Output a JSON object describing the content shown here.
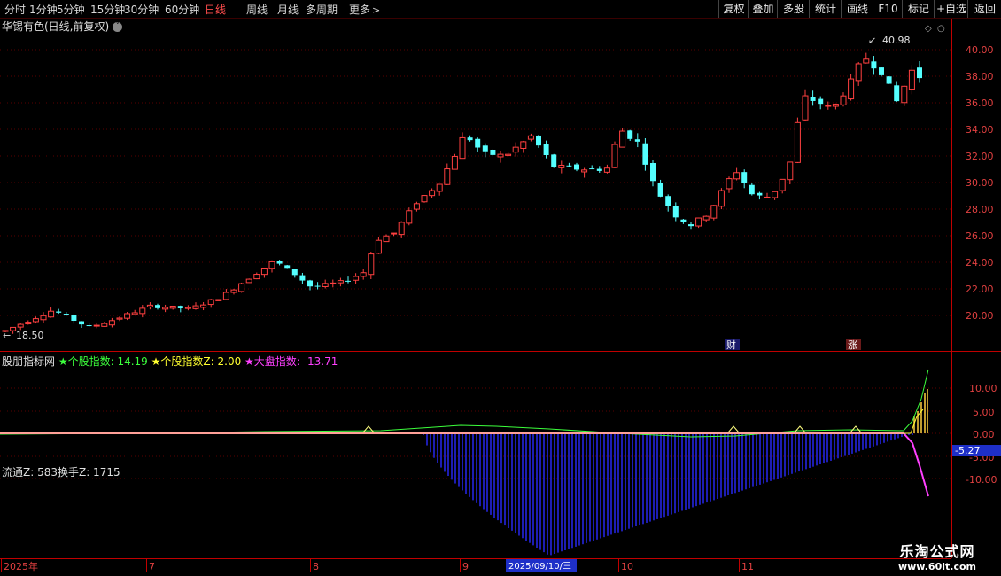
{
  "toolbar": {
    "periods": [
      "分时",
      "1分钟",
      "5分钟",
      "15分钟",
      "30分钟",
      "60分钟",
      "日线",
      "周线",
      "月线",
      "多周期",
      "更多"
    ],
    "active_period": "日线",
    "tools": [
      "复权",
      "叠加",
      "多股",
      "统计",
      "画线",
      "F10",
      "标记",
      "+自选",
      "返回"
    ]
  },
  "main_chart": {
    "title": "华锡有色(日线,前复权)",
    "high_marker": "40.98",
    "low_marker": "18.50",
    "y_ticks": [
      "40.00",
      "38.00",
      "36.00",
      "34.00",
      "32.00",
      "30.00",
      "28.00",
      "26.00",
      "24.00",
      "22.00",
      "20.00"
    ],
    "badges": [
      "财",
      "涨"
    ],
    "colors": {
      "up": "#ff4040",
      "down": "#54ffff",
      "grid": "#5a0000",
      "border": "#a00000"
    }
  },
  "indicator": {
    "name": "股朋指标网",
    "items": [
      {
        "label": "★个股指数: 14.19",
        "color": "#3cff3c"
      },
      {
        "label": "★个股指数Z: 2.00",
        "color": "#ffff30"
      },
      {
        "label": "★大盘指数: -13.71",
        "color": "#ff40ff"
      }
    ],
    "y_ticks": [
      "10.00",
      "5.00",
      "0.00",
      "-5.00",
      "-10.00"
    ],
    "current_value": "-5.27",
    "stats": "流通Z: 583换手Z: 1715"
  },
  "x_axis": {
    "labels": [
      "2025年",
      "7",
      "8",
      "9",
      "10",
      "11"
    ],
    "highlight": "2025/09/10/三"
  },
  "watermark": {
    "line1": "乐淘公式网",
    "line2": "www.60lt.com"
  }
}
